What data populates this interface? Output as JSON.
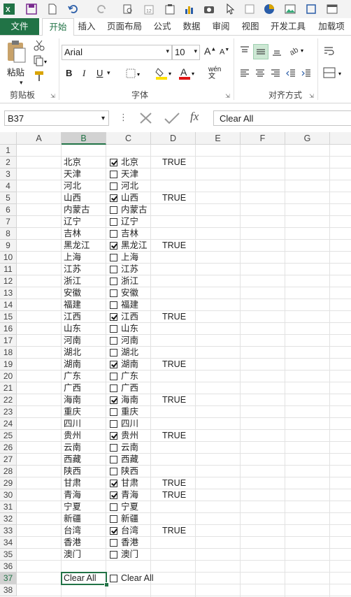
{
  "ribbon_tabs": [
    "文件",
    "开始",
    "插入",
    "页面布局",
    "公式",
    "数据",
    "审阅",
    "视图",
    "开发工具",
    "加载项"
  ],
  "active_tab": "开始",
  "clipboard": {
    "paste_label": "粘贴",
    "group_label": "剪贴板"
  },
  "font": {
    "name": "Arial",
    "size": "10",
    "group_label": "字体",
    "bold": "B",
    "italic": "I",
    "underline": "U",
    "wen": "wén"
  },
  "alignment": {
    "group_label": "对齐方式"
  },
  "formula_bar": {
    "name_box": "B37",
    "content": "Clear All",
    "fx": "fx"
  },
  "columns": [
    "A",
    "B",
    "C",
    "D",
    "E",
    "F",
    "G"
  ],
  "rows": [
    {
      "n": "1",
      "b": "",
      "checked": null,
      "c": "",
      "d": ""
    },
    {
      "n": "2",
      "b": "北京",
      "checked": true,
      "c": "北京",
      "d": "TRUE"
    },
    {
      "n": "3",
      "b": "天津",
      "checked": false,
      "c": "天津",
      "d": ""
    },
    {
      "n": "4",
      "b": "河北",
      "checked": false,
      "c": "河北",
      "d": ""
    },
    {
      "n": "5",
      "b": "山西",
      "checked": true,
      "c": "山西",
      "d": "TRUE"
    },
    {
      "n": "6",
      "b": "内蒙古",
      "checked": false,
      "c": "内蒙古",
      "d": ""
    },
    {
      "n": "7",
      "b": "辽宁",
      "checked": false,
      "c": "辽宁",
      "d": ""
    },
    {
      "n": "8",
      "b": "吉林",
      "checked": false,
      "c": "吉林",
      "d": ""
    },
    {
      "n": "9",
      "b": "黑龙江",
      "checked": true,
      "c": "黑龙江",
      "d": "TRUE"
    },
    {
      "n": "10",
      "b": "上海",
      "checked": false,
      "c": "上海",
      "d": ""
    },
    {
      "n": "11",
      "b": "江苏",
      "checked": false,
      "c": "江苏",
      "d": ""
    },
    {
      "n": "12",
      "b": "浙江",
      "checked": false,
      "c": "浙江",
      "d": ""
    },
    {
      "n": "13",
      "b": "安徽",
      "checked": false,
      "c": "安徽",
      "d": ""
    },
    {
      "n": "14",
      "b": "福建",
      "checked": false,
      "c": "福建",
      "d": ""
    },
    {
      "n": "15",
      "b": "江西",
      "checked": true,
      "c": "江西",
      "d": "TRUE"
    },
    {
      "n": "16",
      "b": "山东",
      "checked": false,
      "c": "山东",
      "d": ""
    },
    {
      "n": "17",
      "b": "河南",
      "checked": false,
      "c": "河南",
      "d": ""
    },
    {
      "n": "18",
      "b": "湖北",
      "checked": false,
      "c": "湖北",
      "d": ""
    },
    {
      "n": "19",
      "b": "湖南",
      "checked": true,
      "c": "湖南",
      "d": "TRUE"
    },
    {
      "n": "20",
      "b": "广东",
      "checked": false,
      "c": "广东",
      "d": ""
    },
    {
      "n": "21",
      "b": "广西",
      "checked": false,
      "c": "广西",
      "d": ""
    },
    {
      "n": "22",
      "b": "海南",
      "checked": true,
      "c": "海南",
      "d": "TRUE"
    },
    {
      "n": "23",
      "b": "重庆",
      "checked": false,
      "c": "重庆",
      "d": ""
    },
    {
      "n": "24",
      "b": "四川",
      "checked": false,
      "c": "四川",
      "d": ""
    },
    {
      "n": "25",
      "b": "贵州",
      "checked": true,
      "c": "贵州",
      "d": "TRUE"
    },
    {
      "n": "26",
      "b": "云南",
      "checked": false,
      "c": "云南",
      "d": ""
    },
    {
      "n": "27",
      "b": "西藏",
      "checked": false,
      "c": "西藏",
      "d": ""
    },
    {
      "n": "28",
      "b": "陕西",
      "checked": false,
      "c": "陕西",
      "d": ""
    },
    {
      "n": "29",
      "b": "甘肃",
      "checked": true,
      "c": "甘肃",
      "d": "TRUE"
    },
    {
      "n": "30",
      "b": "青海",
      "checked": true,
      "c": "青海",
      "d": "TRUE"
    },
    {
      "n": "31",
      "b": "宁夏",
      "checked": false,
      "c": "宁夏",
      "d": ""
    },
    {
      "n": "32",
      "b": "新疆",
      "checked": false,
      "c": "新疆",
      "d": ""
    },
    {
      "n": "33",
      "b": "台湾",
      "checked": true,
      "c": "台湾",
      "d": "TRUE"
    },
    {
      "n": "34",
      "b": "香港",
      "checked": false,
      "c": "香港",
      "d": ""
    },
    {
      "n": "35",
      "b": "澳门",
      "checked": false,
      "c": "澳门",
      "d": ""
    },
    {
      "n": "36",
      "b": "",
      "checked": null,
      "c": "",
      "d": ""
    },
    {
      "n": "37",
      "b": "Clear All",
      "checked": false,
      "c": "Clear All",
      "d": ""
    },
    {
      "n": "38",
      "b": "",
      "checked": null,
      "c": "",
      "d": ""
    }
  ],
  "colors": {
    "excel_green": "#217346",
    "header_bg": "#f3f3f3"
  }
}
